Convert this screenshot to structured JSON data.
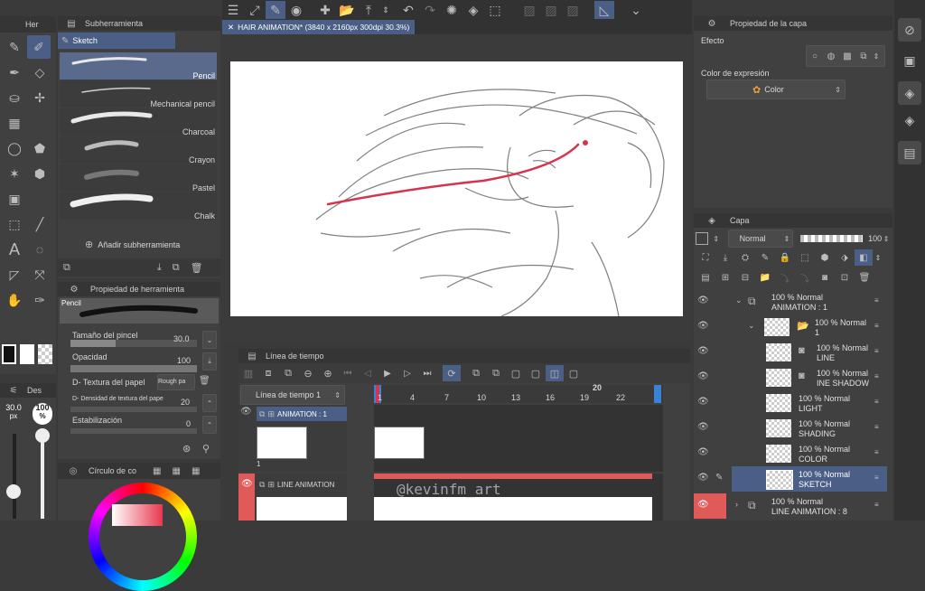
{
  "toolbar_left_tab": "Her",
  "subtool_header": "Subherramienta",
  "subtool_group": "Sketch",
  "brushes": [
    "Pencil",
    "Mechanical pencil",
    "Charcoal",
    "Crayon",
    "Pastel",
    "Chalk"
  ],
  "add_subtool": "Añadir subherramienta",
  "tool_prop_header": "Propiedad de herramienta",
  "tool_prop_name": "Pencil",
  "brush_size_label": "Tamaño del pincel",
  "brush_size_value": "30.0",
  "opacity_label": "Opacidad",
  "opacity_value": "100",
  "paper_texture_label": "D- Textura del papel",
  "paper_texture_value": "Rough pa",
  "paper_density_label": "D- Densidad de textura del pape",
  "paper_density_value": "20",
  "stabilization_label": "Estabilización",
  "stabilization_value": "0",
  "size_badge": "30.0",
  "size_unit": "px",
  "opacity_badge": "100",
  "opacity_unit": "%",
  "left_mini_tab": "Des",
  "color_circle_header": "Círculo de co",
  "doc_tab": "HAIR ANIMATION* (3840 x 2160px 300dpi 30.3%)",
  "timeline_header": "Línea de tiempo",
  "timeline_name": "Línea de tiempo 1",
  "frame_numbers": [
    "1",
    "4",
    "7",
    "10",
    "13",
    "16",
    "19",
    "22"
  ],
  "frame_top_number": "20",
  "track1_name": "ANIMATION : 1",
  "track2_name": "LINE ANIMATION",
  "cel_label": "1",
  "watermark": "@kevinfm_art",
  "layer_prop_header": "Propiedad de la capa",
  "effect_label": "Efecto",
  "expression_label": "Color de expresión",
  "expression_value": "Color",
  "layer_header": "Capa",
  "blend_mode": "Normal",
  "layer_opacity": "100",
  "layers": [
    {
      "pct": "100 %",
      "mode": "Normal",
      "name": "ANIMATION : 1"
    },
    {
      "pct": "100 %",
      "mode": "Normal",
      "name": "1"
    },
    {
      "pct": "100 %",
      "mode": "Normal",
      "name": "LINE"
    },
    {
      "pct": "100 %",
      "mode": "Normal",
      "name": "INE SHADOW"
    },
    {
      "pct": "100 %",
      "mode": "Normal",
      "name": "LIGHT"
    },
    {
      "pct": "100 %",
      "mode": "Normal",
      "name": "SHADING"
    },
    {
      "pct": "100 %",
      "mode": "Normal",
      "name": "COLOR"
    },
    {
      "pct": "100 %",
      "mode": "Normal",
      "name": "SKETCH"
    },
    {
      "pct": "100 %",
      "mode": "Normal",
      "name": "LINE ANIMATION : 8"
    }
  ]
}
